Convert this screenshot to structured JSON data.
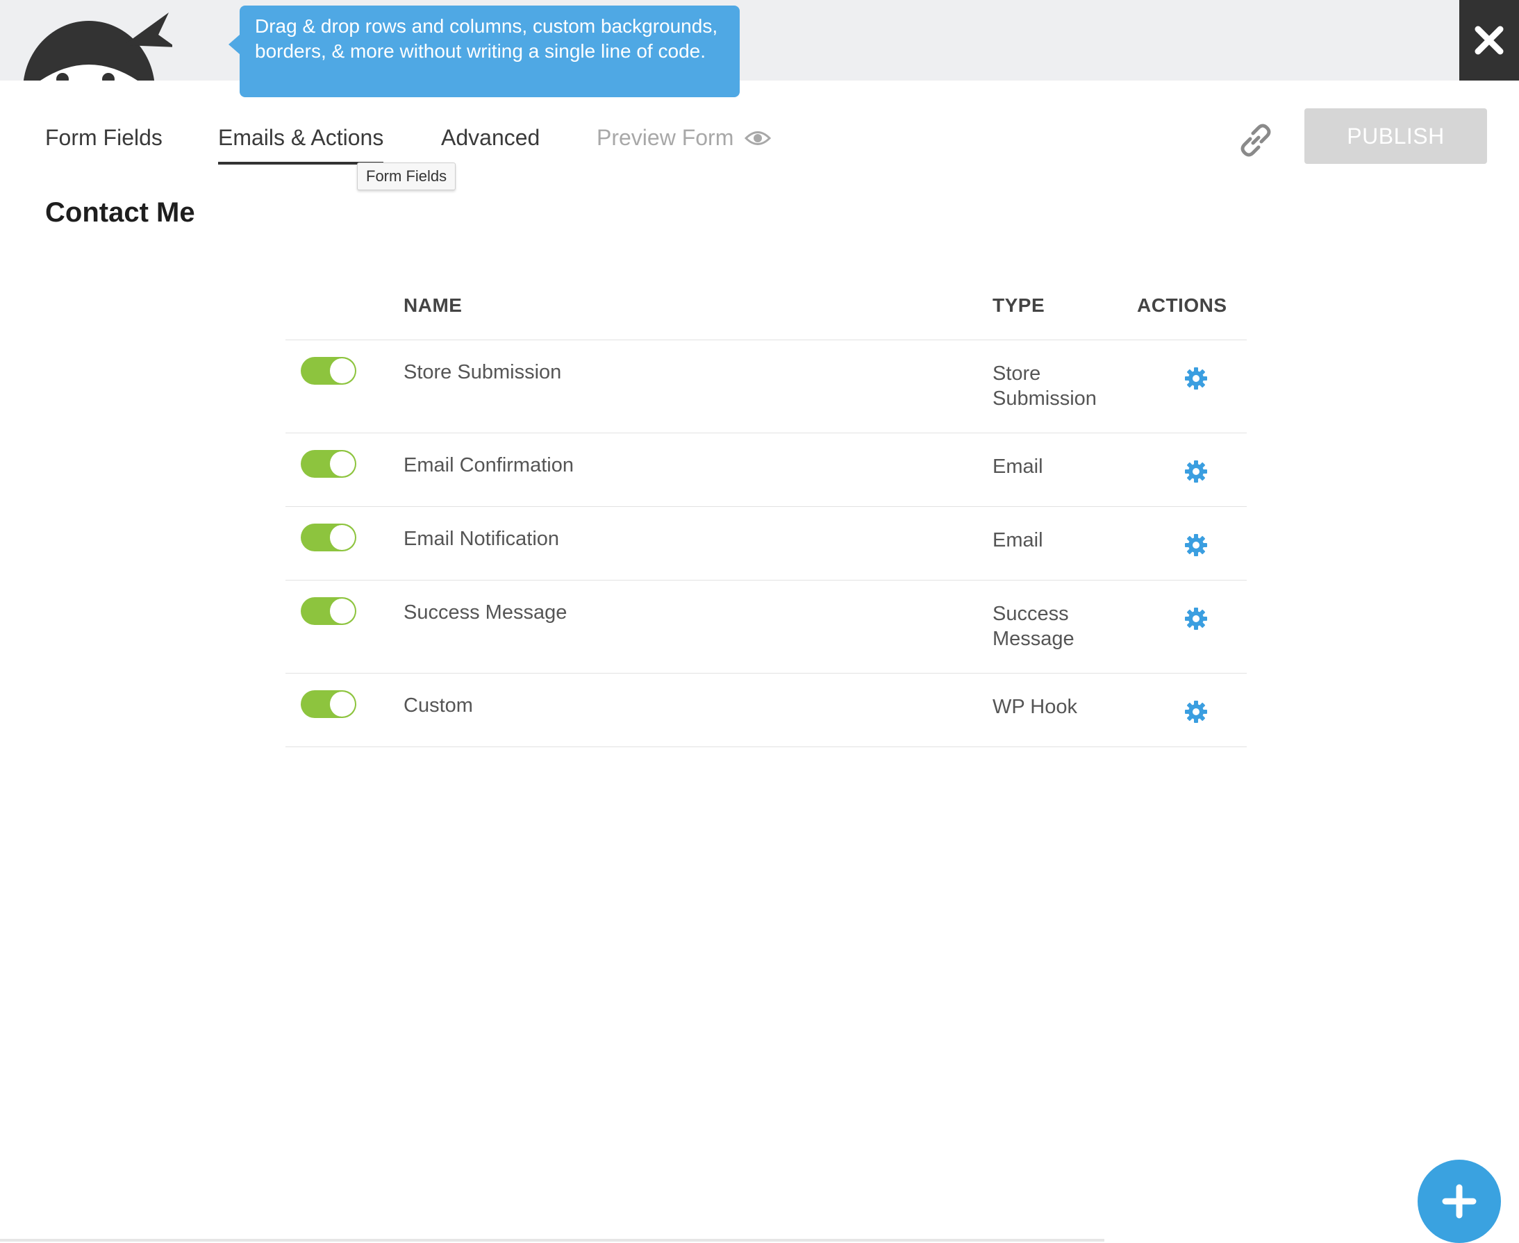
{
  "promo": {
    "text": "Drag & drop rows and columns, custom backgrounds, borders, & more without writing a single line of code."
  },
  "tabs": [
    {
      "label": "Form Fields"
    },
    {
      "label": "Emails & Actions",
      "active": true
    },
    {
      "label": "Advanced"
    },
    {
      "label": "Preview Form"
    }
  ],
  "tooltip": {
    "text": "Form Fields"
  },
  "publish": {
    "label": "PUBLISH"
  },
  "form": {
    "title": "Contact Me"
  },
  "table": {
    "headers": {
      "name": "NAME",
      "type": "TYPE",
      "actions": "ACTIONS"
    },
    "rows": [
      {
        "enabled": true,
        "name": "Store Submission",
        "type": "Store Submission"
      },
      {
        "enabled": true,
        "name": "Email Confirmation",
        "type": "Email"
      },
      {
        "enabled": true,
        "name": "Email Notification",
        "type": "Email"
      },
      {
        "enabled": true,
        "name": "Success Message",
        "type": "Success Message"
      },
      {
        "enabled": true,
        "name": "Custom",
        "type": "WP Hook"
      }
    ]
  },
  "icons": {
    "logo": "ninja-logo",
    "close": "close-icon",
    "preview": "eye-icon",
    "link": "link-icon",
    "settings": "gear-icon",
    "add": "plus-icon"
  },
  "colors": {
    "accent": "#4fa8e4",
    "toggle_on": "#8dc43e",
    "gear": "#3a9ee0",
    "publish_disabled": "#d6d6d6",
    "topbar": "#eeeff1",
    "close_bg": "#323232"
  }
}
